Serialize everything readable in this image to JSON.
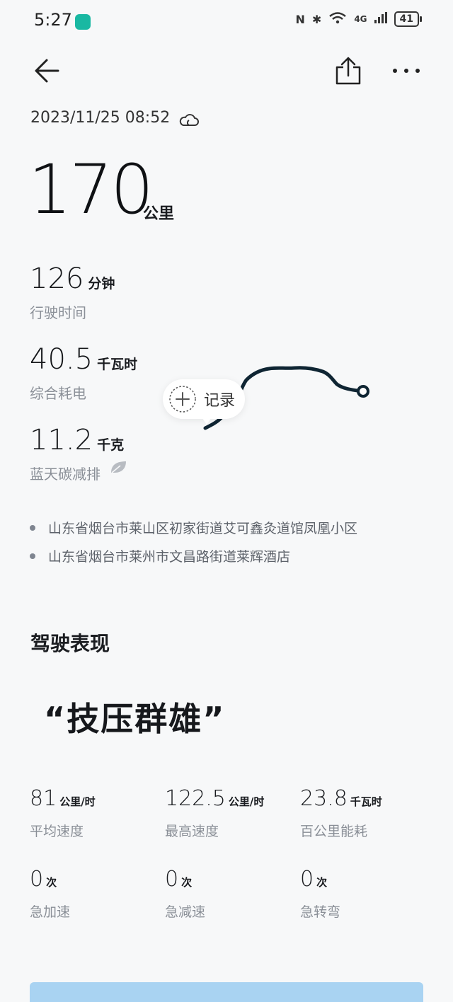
{
  "status_bar": {
    "time": "5:27",
    "network": "4G",
    "battery": "41"
  },
  "toolbar": {
    "back_icon": "arrow-left-icon",
    "share_icon": "share-icon",
    "more_icon": "more-horizontal-icon"
  },
  "trip": {
    "datetime": "2023/11/25 08:52",
    "weather_icon": "cloud-icon",
    "distance": {
      "value": "170",
      "unit": "公里"
    },
    "stats": [
      {
        "value": "126",
        "unit": "分钟",
        "label": "行驶时间"
      },
      {
        "value": "40.5",
        "unit": "千瓦时",
        "label": "综合耗电"
      },
      {
        "value": "11.2",
        "unit": "千克",
        "label": "蓝天碳减排"
      }
    ],
    "record_button": {
      "label": "记录"
    },
    "addresses": [
      "山东省烟台市莱山区初家街道艾可鑫灸道馆凤凰小区",
      "山东省烟台市莱州市文昌路街道莱辉酒店"
    ]
  },
  "driving": {
    "title": "驾驶表现",
    "badge": "“技压群雄”",
    "metrics": [
      {
        "value": "81",
        "unit": "公里/时",
        "label": "平均速度"
      },
      {
        "value": "122.5",
        "unit": "公里/时",
        "label": "最高速度"
      },
      {
        "value": "23.8",
        "unit": "千瓦时",
        "label": "百公里能耗"
      },
      {
        "value": "0",
        "unit": "次",
        "label": "急加速"
      },
      {
        "value": "0",
        "unit": "次",
        "label": "急减速"
      },
      {
        "value": "0",
        "unit": "次",
        "label": "急转弯"
      }
    ]
  },
  "colors": {
    "route": "#0f2533",
    "background": "#f7f8f9",
    "bottom_card": "#a9d3f2"
  }
}
